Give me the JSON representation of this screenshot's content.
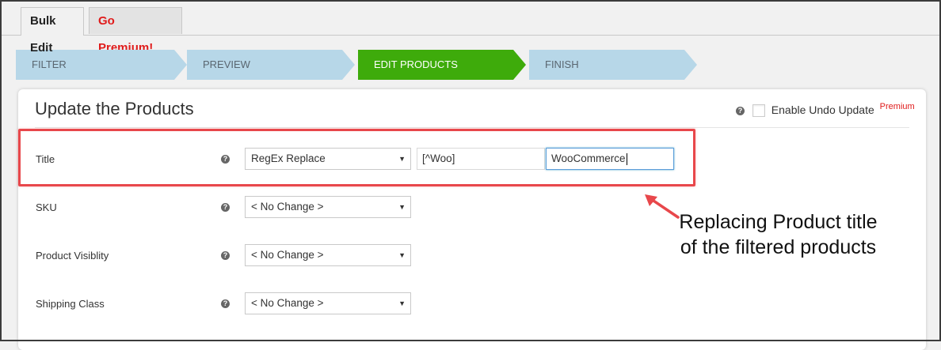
{
  "tabs": [
    {
      "label": "Bulk Edit",
      "active": true
    },
    {
      "label": "Go Premium!",
      "color": "#e01b1b"
    }
  ],
  "steps": [
    {
      "label": "FILTER"
    },
    {
      "label": "PREVIEW"
    },
    {
      "label": "EDIT PRODUCTS",
      "active": true
    },
    {
      "label": "FINISH"
    }
  ],
  "panel": {
    "title": "Update the Products",
    "undo_label": "Enable Undo Update",
    "undo_checked": false,
    "premium_badge": "Premium"
  },
  "rows": [
    {
      "label": "Title",
      "select_value": "RegEx Replace",
      "find_value": "[^Woo]",
      "replace_value": "WooCommerce"
    },
    {
      "label": "SKU",
      "select_value": "< No Change >"
    },
    {
      "label": "Product Visiblity",
      "select_value": "< No Change >"
    },
    {
      "label": "Shipping Class",
      "select_value": "< No Change >"
    }
  ],
  "help_glyph": "?",
  "caret_glyph": "▼",
  "annotation": {
    "text": "Replacing Product title of the filtered products",
    "color": "#e8474b"
  },
  "colors": {
    "step_inactive": "#b7d7e8",
    "step_active": "#3eab0b",
    "premium_red": "#e01b1b"
  },
  "icons": [
    "help-icon",
    "dropdown-caret-icon",
    "arrow-icon"
  ]
}
